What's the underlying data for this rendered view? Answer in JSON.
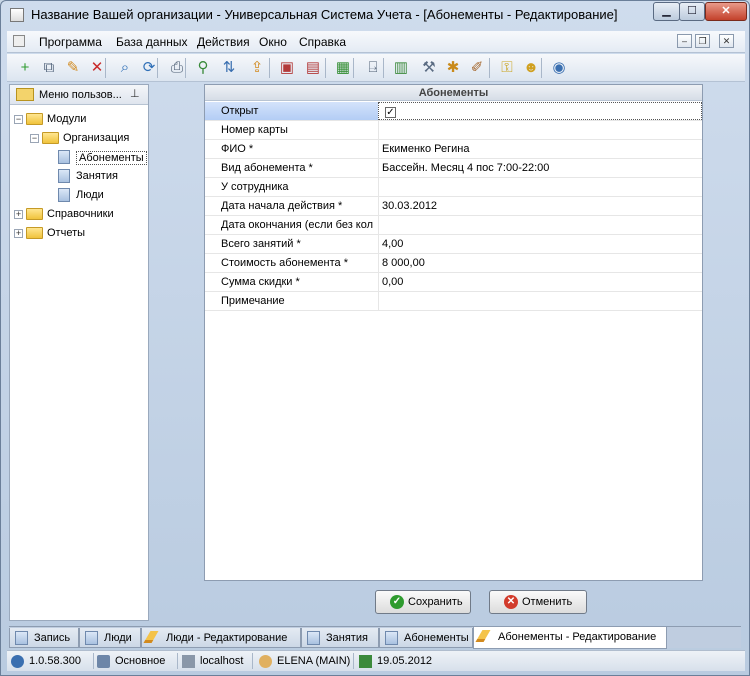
{
  "window": {
    "title": "Название Вашей организации - Универсальная Система Учета - [Абонементы - Редактирование]",
    "minimize": "▁",
    "maximize": "☐",
    "close": "✕"
  },
  "menu": {
    "items": [
      "Программа",
      "База данных",
      "Действия",
      "Окно",
      "Справка"
    ],
    "mdi_min": "–",
    "mdi_restore": "❐",
    "mdi_close": "✕"
  },
  "toolbar": {
    "buttons": [
      {
        "icon": "add-icon",
        "glyph": "+",
        "color": "#2e9b2e"
      },
      {
        "icon": "copy-icon",
        "glyph": "⧉",
        "color": "#5a6b82"
      },
      {
        "icon": "edit-pencil-icon",
        "glyph": "✎",
        "color": "#d28a1e"
      },
      {
        "icon": "delete-icon",
        "glyph": "✕",
        "color": "#c92a2a"
      },
      {
        "icon": "search-icon",
        "glyph": "⌕",
        "color": "#2f6fb7"
      },
      {
        "icon": "refresh-icon",
        "glyph": "⟳",
        "color": "#2f6fb7"
      },
      {
        "icon": "print-icon",
        "glyph": "⎙",
        "color": "#4a5b71"
      },
      {
        "icon": "filter-icon",
        "glyph": "⚲",
        "color": "#3a8a3a"
      },
      {
        "icon": "sort-icon",
        "glyph": "⇅",
        "color": "#3a6fb0"
      },
      {
        "icon": "export-icon",
        "glyph": "⇪",
        "color": "#d28a1e"
      },
      {
        "icon": "window-new-icon",
        "glyph": "▣",
        "color": "#b33a3a"
      },
      {
        "icon": "window-close-icon",
        "glyph": "▤",
        "color": "#b33a3a"
      },
      {
        "icon": "excel-icon",
        "glyph": "▦",
        "color": "#2e8b2e"
      },
      {
        "icon": "exit-door-icon",
        "glyph": "⍈",
        "color": "#4a5b71"
      },
      {
        "icon": "calendar-icon",
        "glyph": "▥",
        "color": "#3c8a3c"
      },
      {
        "icon": "tools-icon",
        "glyph": "⚒",
        "color": "#5a6b82"
      },
      {
        "icon": "settings-icon",
        "glyph": "✱",
        "color": "#c98a1a"
      },
      {
        "icon": "report-icon",
        "glyph": "✐",
        "color": "#a4652a"
      },
      {
        "icon": "key-icon",
        "glyph": "⚿",
        "color": "#c9a21a"
      },
      {
        "icon": "users-icon",
        "glyph": "☻",
        "color": "#d0a020"
      },
      {
        "icon": "help-icon",
        "glyph": "◉",
        "color": "#3a6fb0"
      }
    ]
  },
  "sidebar": {
    "header": "Меню пользов...",
    "pin": "⊥",
    "tree": [
      {
        "label": "Модули",
        "type": "folder",
        "expanded": true,
        "exp": "−"
      },
      {
        "label": "Организация",
        "type": "folder",
        "expanded": true,
        "exp": "−"
      },
      {
        "label": "Абонементы",
        "type": "doc",
        "selected": true
      },
      {
        "label": "Занятия",
        "type": "doc"
      },
      {
        "label": "Люди",
        "type": "doc"
      },
      {
        "label": "Справочники",
        "type": "folder",
        "exp": "+"
      },
      {
        "label": "Отчеты",
        "type": "folder",
        "exp": "+"
      }
    ]
  },
  "form": {
    "title": "Абонементы",
    "fields": [
      {
        "label": "Открыт",
        "value": "",
        "checkbox": true,
        "checked": "✓"
      },
      {
        "label": "Номер карты",
        "value": ""
      },
      {
        "label": "ФИО *",
        "value": "Екименко Регина"
      },
      {
        "label": "Вид абонемента *",
        "value": "Бассейн. Месяц 4 пос 7:00-22:00"
      },
      {
        "label": "У сотрудника",
        "value": ""
      },
      {
        "label": "Дата начала действия *",
        "value": "30.03.2012"
      },
      {
        "label": "Дата окончания (если без кол",
        "value": ""
      },
      {
        "label": "Всего занятий *",
        "value": "4,00"
      },
      {
        "label": "Стоимость абонемента *",
        "value": "8 000,00"
      },
      {
        "label": "Сумма скидки *",
        "value": "0,00"
      },
      {
        "label": "Примечание",
        "value": ""
      }
    ],
    "save_label": "Сохранить",
    "cancel_label": "Отменить"
  },
  "tabs": [
    {
      "label": "Запись",
      "icon": "window-icon"
    },
    {
      "label": "Люди",
      "icon": "table-icon"
    },
    {
      "label": "Люди - Редактирование",
      "icon": "edit-pencil-icon"
    },
    {
      "label": "Занятия",
      "icon": "table-icon"
    },
    {
      "label": "Абонементы",
      "icon": "table-icon"
    },
    {
      "label": "Абонементы - Редактирование",
      "icon": "edit-pencil-icon",
      "active": true
    }
  ],
  "status": {
    "version": "1.0.58.300",
    "database": "Основное",
    "server": "localhost",
    "user": "ELENA (MAIN)",
    "date": "19.05.2012"
  },
  "colors": {
    "accent": "#b3cdf5",
    "save_icon": "#2e9b2e",
    "cancel_icon": "#d23b2b"
  }
}
